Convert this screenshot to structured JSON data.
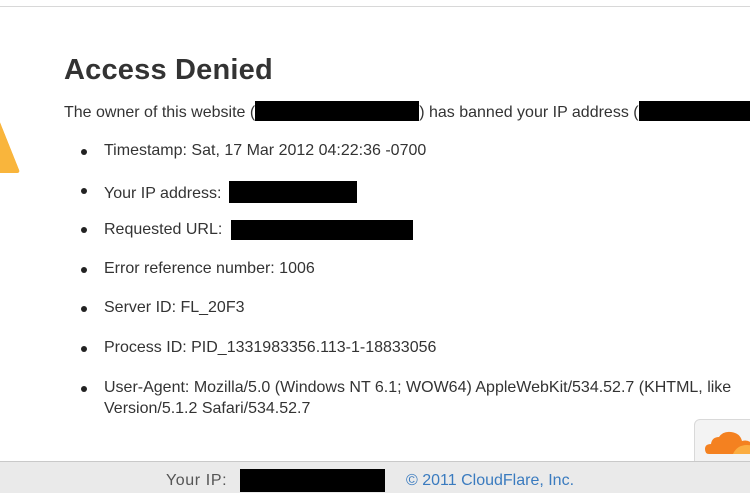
{
  "heading": "Access Denied",
  "intro": {
    "prefix": "The owner of this website (",
    "middle": ") has banned your IP address (",
    "redacted": true
  },
  "details": [
    {
      "label": "Timestamp: Sat, 17 Mar 2012 04:22:36 -0700"
    },
    {
      "label": "Your IP address:",
      "redacted": true
    },
    {
      "label": "Requested URL:",
      "redacted": true
    },
    {
      "label": "Error reference number: 1006"
    },
    {
      "label": "Server ID: FL_20F3"
    },
    {
      "label": "Process ID: PID_1331983356.113-1-18833056"
    },
    {
      "label": "User-Agent: Mozilla/5.0 (Windows NT 6.1; WOW64) AppleWebKit/534.52.7 (KHTML, like",
      "label_line2": "Version/5.1.2 Safari/534.52.7"
    }
  ],
  "footer": {
    "ip_label": "Your IP:",
    "copyright_link": "© 2011 CloudFlare, Inc."
  },
  "colors": {
    "warning": "#f6a21a",
    "cloud": "#f48120",
    "link": "#3a7bbf",
    "redaction": "#000000"
  },
  "icons": [
    "warning-icon",
    "cloudflare-cloud-icon"
  ]
}
